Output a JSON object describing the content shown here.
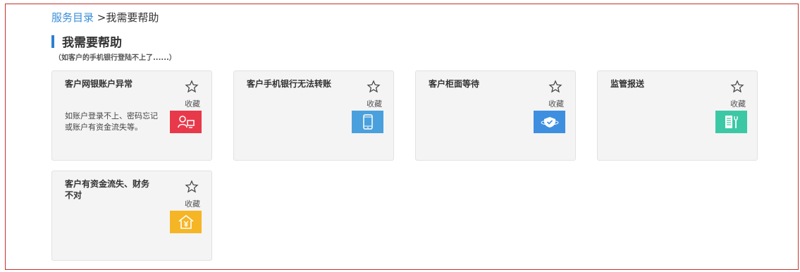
{
  "breadcrumb": {
    "root": "服务目录",
    "separator": " >",
    "current": "我需要帮助"
  },
  "section": {
    "title": "我需要帮助",
    "subtitle": "（如客户的手机银行登陆不上了......）"
  },
  "cards": [
    {
      "title": "客户网银账户异常",
      "fav_label": "收藏",
      "desc": "如账户登录不上、密码忘记或账户有资金流失等。",
      "icon": "user-computer-icon",
      "color": "#e8394b"
    },
    {
      "title": "客户手机银行无法转账",
      "fav_label": "收藏",
      "desc": "",
      "icon": "mobile-phone-icon",
      "color": "#4aa0dc"
    },
    {
      "title": "客户柜面等待",
      "fav_label": "收藏",
      "desc": "",
      "icon": "shield-check-icon",
      "color": "#3e8fe0"
    },
    {
      "title": "监管报送",
      "fav_label": "收藏",
      "desc": "",
      "icon": "report-tools-icon",
      "color": "#3cc8a4"
    },
    {
      "title": "客户有资金流失、财务不对",
      "fav_label": "收藏",
      "desc": "",
      "icon": "house-yuan-icon",
      "color": "#f5b525"
    }
  ]
}
